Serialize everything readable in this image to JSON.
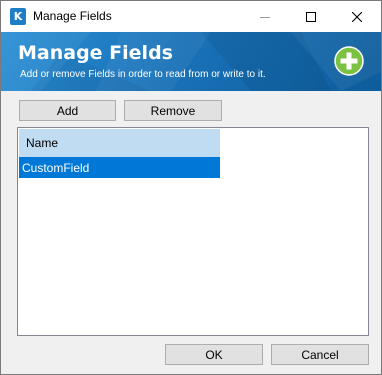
{
  "window": {
    "title": "Manage Fields",
    "icon_letter": "K",
    "controls": [
      "minimize-icon",
      "maximize-icon",
      "close-icon"
    ]
  },
  "banner": {
    "title": "Manage Fields",
    "subtitle": "Add or remove Fields in order to read from or write to it.",
    "icon": "add-circle-icon"
  },
  "toolbar": {
    "add_label": "Add",
    "remove_label": "Remove"
  },
  "list": {
    "columns": [
      "Name"
    ],
    "rows": [
      {
        "name": "CustomField",
        "selected": true
      }
    ]
  },
  "footer": {
    "ok_label": "OK",
    "cancel_label": "Cancel"
  },
  "colors": {
    "banner": "#1a72b8",
    "selection": "#0078d7",
    "header": "#bfdcf3",
    "add_icon": "#7cc242"
  }
}
